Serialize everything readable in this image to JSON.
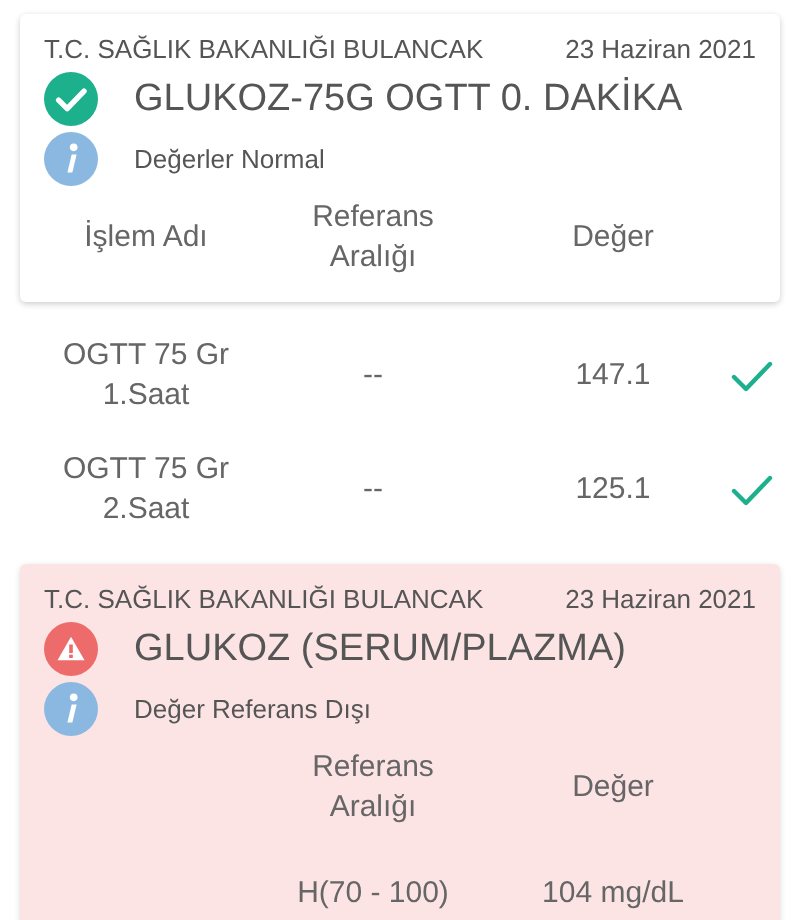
{
  "results": [
    {
      "kind": "normal",
      "institution": "T.C. SAĞLIK BAKANLIĞI BULANCAK",
      "date": "23 Haziran 2021",
      "title": "GLUKOZ-75G OGTT 0. DAKİKA",
      "message": "Değerler Normal",
      "columns": [
        {
          "kind": "name",
          "label": "İşlem Adı"
        },
        {
          "kind": "reference",
          "label": "Referans Aralığı"
        },
        {
          "kind": "value",
          "label": "Değer"
        }
      ],
      "rows": [
        {
          "name": "OGTT 75 Gr 1.Saat",
          "reference": "--",
          "value": "147.1",
          "ok": true
        },
        {
          "name": "OGTT 75 Gr 2.Saat",
          "reference": "--",
          "value": "125.1",
          "ok": true
        }
      ]
    },
    {
      "kind": "abnormal",
      "institution": "T.C. SAĞLIK BAKANLIĞI BULANCAK",
      "date": "23 Haziran 2021",
      "title": "GLUKOZ (SERUM/PLAZMA)",
      "message": "Değer Referans Dışı",
      "columns": [
        {
          "kind": "reference",
          "label": "Referans Aralığı"
        },
        {
          "kind": "value",
          "label": "Değer"
        }
      ],
      "rows": [
        {
          "reference": "H(70 - 100)",
          "value": "104 mg/dL",
          "ok": false
        }
      ]
    }
  ]
}
